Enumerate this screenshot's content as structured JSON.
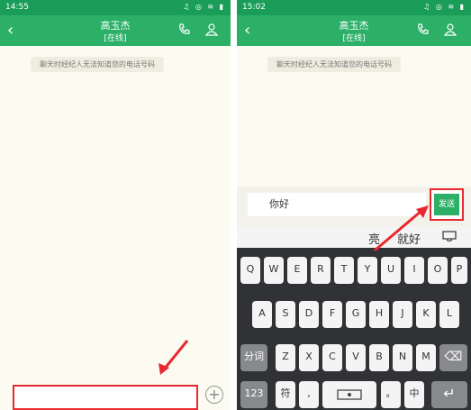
{
  "left": {
    "status_time": "14:55",
    "status_icons": "♫ ◎ ≋ ▮",
    "contact_name": "高玉杰",
    "contact_status": "[在线]",
    "back_icon": "‹",
    "notice": "聊天时经纪人无法知道您的电话号码",
    "plus": "+"
  },
  "right": {
    "status_time": "15:02",
    "status_icons": "♫ ◎ ≋ ▮",
    "contact_name": "高玉杰",
    "contact_status": "[在线]",
    "back_icon": "‹",
    "notice": "聊天时经纪人无法知道您的电话号码",
    "input_value": "你好",
    "send_label": "发送",
    "suggestions": [
      "亮",
      "就好"
    ],
    "rows": [
      [
        "Q",
        "W",
        "E",
        "R",
        "T",
        "Y",
        "U",
        "I",
        "O",
        "P"
      ],
      [
        "A",
        "S",
        "D",
        "F",
        "G",
        "H",
        "J",
        "K",
        "L"
      ],
      [
        "Z",
        "X",
        "C",
        "V",
        "B",
        "N",
        "M"
      ]
    ],
    "key_fenci": "分词",
    "key_123": "123",
    "key_fu": "符",
    "key_comma": ",",
    "key_dot": "。",
    "key_zhong": "中",
    "key_backspace": "⌫",
    "key_enter": "↵"
  },
  "colors": {
    "brand_green": "#2cb068",
    "status_green": "#1a9d58",
    "highlight_red": "#e8282f"
  }
}
